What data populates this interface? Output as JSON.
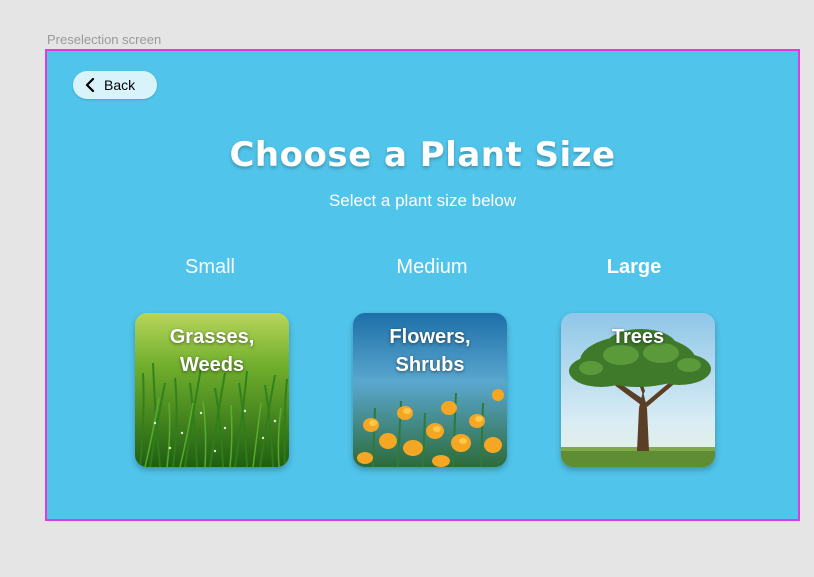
{
  "frame_label": "Preselection screen",
  "back": {
    "label": "Back"
  },
  "header": {
    "title": "Choose a Plant Size",
    "subtitle": "Select a plant size below"
  },
  "sizes": [
    {
      "label": "Small",
      "card_text_line1": "Grasses,",
      "card_text_line2": "Weeds"
    },
    {
      "label": "Medium",
      "card_text_line1": "Flowers,",
      "card_text_line2": "Shrubs"
    },
    {
      "label": "Large",
      "card_text_line1": "Trees",
      "card_text_line2": ""
    }
  ],
  "colors": {
    "background": "#50c4ea",
    "frame_border": "#e33bd8",
    "back_button": "#d9f3fb"
  },
  "icons": {
    "back": "chevron-left-icon"
  }
}
